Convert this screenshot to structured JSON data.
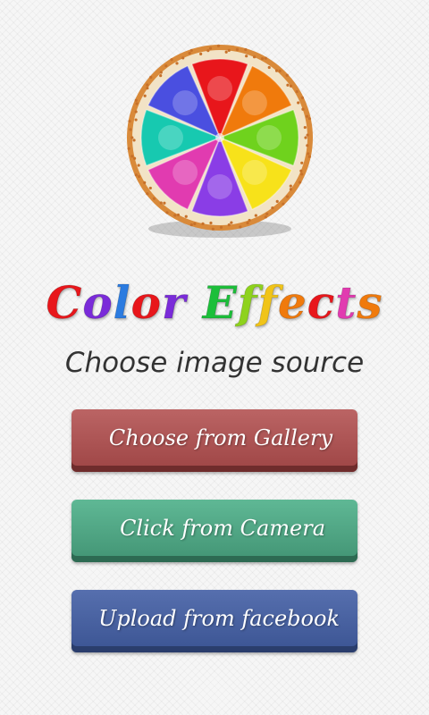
{
  "logo": {
    "icon": "color-wheel-icon",
    "segment_colors": [
      "#e8161b",
      "#f07a0c",
      "#6fd21d",
      "#f7e21a",
      "#8a3de6",
      "#e13bb0",
      "#17c9b0",
      "#4a4fe0"
    ],
    "rim_color": "#f2e3c6",
    "crust_color": "#d98a3a"
  },
  "title": {
    "words": [
      {
        "text": "Color",
        "colors": [
          "#e8161b",
          "#7a2bd9",
          "#2b7be0",
          "#e8161b",
          "#7a2bd9"
        ]
      },
      {
        "text": "Effects",
        "colors": [
          "#1cbf3a",
          "#8ed21d",
          "#f0c419",
          "#f07a0c",
          "#e8161b",
          "#e13bb0",
          "#f07a0c"
        ]
      }
    ]
  },
  "subtitle": "Choose image source",
  "buttons": {
    "gallery_label": "Choose from Gallery",
    "camera_label": "Click from Camera",
    "facebook_label": "Upload from facebook"
  }
}
